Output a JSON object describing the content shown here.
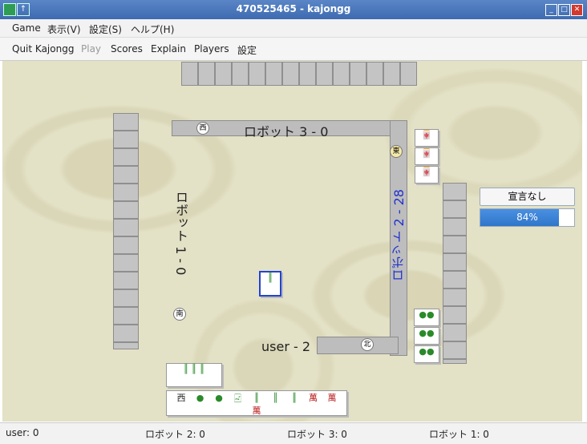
{
  "window": {
    "title": "470525465 - kajongg"
  },
  "menu": [
    "Game",
    "表示(V)",
    "設定(S)",
    "ヘルプ(H)"
  ],
  "toolbar": [
    "Quit Kajongg",
    "Play",
    "Scores",
    "Explain",
    "Players",
    "設定"
  ],
  "players": {
    "north": "ロボット 3 - 0",
    "west": "ロボット 1 - 0",
    "east": "ロボット 2 - 28",
    "south": "user - 2"
  },
  "claim_button": "宣言なし",
  "progress": {
    "value": 84,
    "label": "84%"
  },
  "hand_tiles": [
    "西",
    "●",
    "●",
    "🀐",
    "║",
    "║",
    "║",
    "萬",
    "萬",
    "萬"
  ],
  "statusbar": [
    "user: 0",
    "ロボット 2: 0",
    "ロボット 3: 0",
    "ロボット 1: 0"
  ],
  "colors": {
    "board": "#e3e1c6",
    "accent": "#2f75c9",
    "east_label": "#2233cc"
  }
}
